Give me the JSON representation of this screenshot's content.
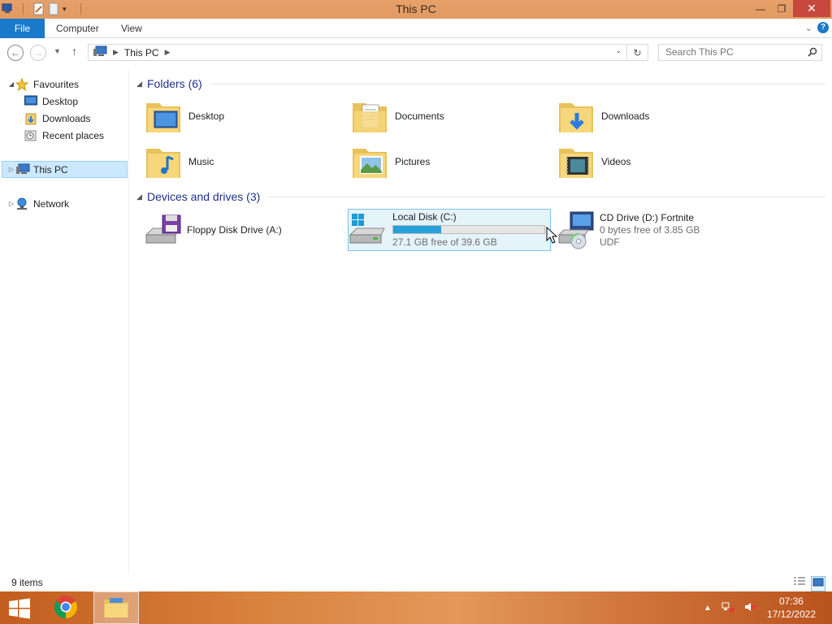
{
  "window": {
    "title": "This PC"
  },
  "ribbon": {
    "tabs": [
      "File",
      "Computer",
      "View"
    ]
  },
  "address": {
    "path": [
      "This PC"
    ],
    "search_placeholder": "Search This PC"
  },
  "nav": {
    "favourites": "Favourites",
    "fav_items": [
      "Desktop",
      "Downloads",
      "Recent places"
    ],
    "this_pc": "This PC",
    "network": "Network"
  },
  "folders": {
    "header": "Folders (6)",
    "items": [
      "Desktop",
      "Documents",
      "Downloads",
      "Music",
      "Pictures",
      "Videos"
    ]
  },
  "devices": {
    "header": "Devices and drives (3)",
    "floppy": {
      "name": "Floppy Disk Drive (A:)"
    },
    "local": {
      "name": "Local Disk (C:)",
      "free": "27.1 GB free of 39.6 GB",
      "used_fraction": 0.316
    },
    "cd": {
      "name": "CD Drive (D:) Fortnite",
      "free": "0 bytes free of 3.85 GB",
      "fs": "UDF"
    }
  },
  "status": {
    "items_count": "9 items"
  },
  "taskbar": {
    "time": "07:36",
    "date": "17/12/2022",
    "apps": [
      "chrome",
      "file-explorer"
    ]
  },
  "colors": {
    "accent": "#1979ca",
    "titlebar": "#e19a62",
    "drive_bar": "#26a0da",
    "selection": "#cce8ff"
  }
}
